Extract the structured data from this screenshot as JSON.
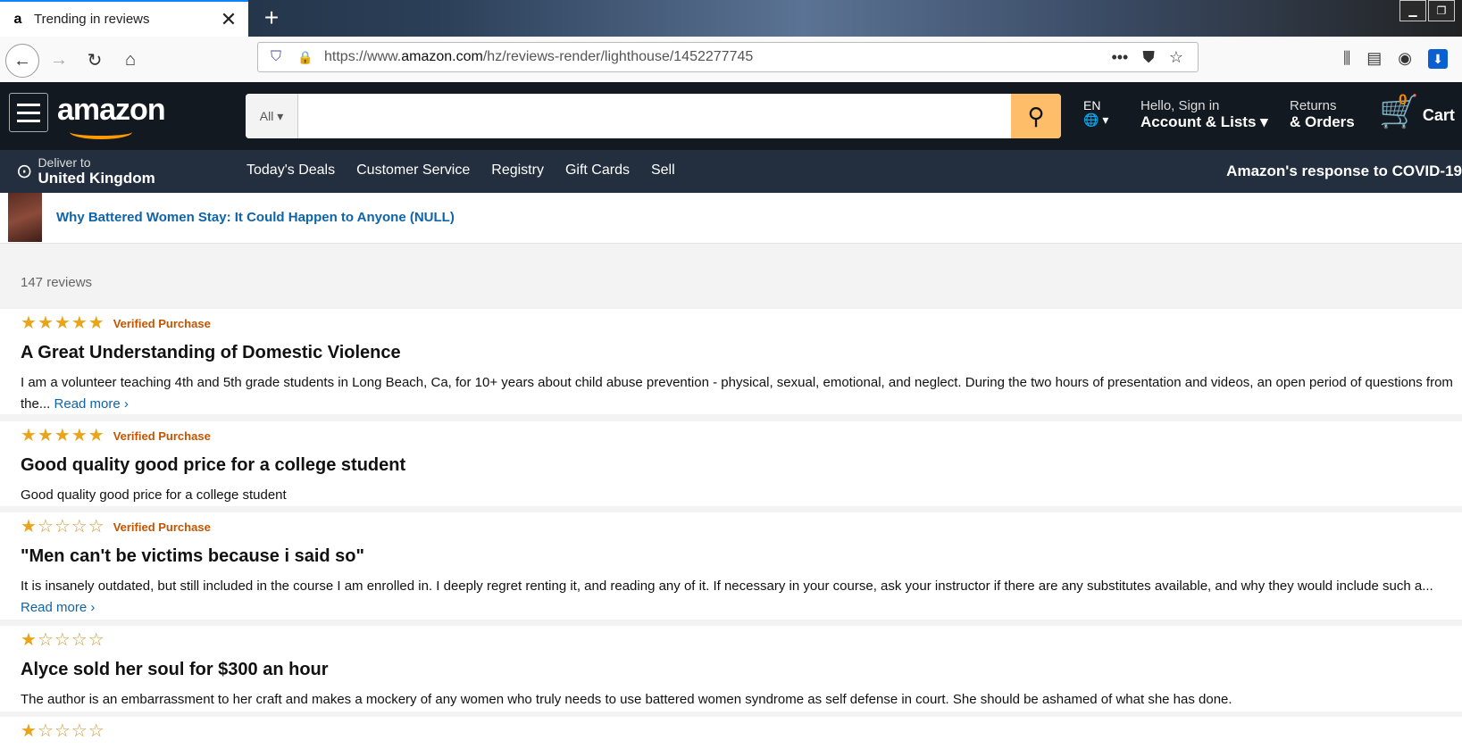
{
  "browser": {
    "tab_title": "Trending in reviews",
    "favicon": "a",
    "close_glyph": "✕",
    "new_tab_glyph": "+",
    "url_prefix": "https://www.",
    "url_domain": "amazon.com",
    "url_path": "/hz/reviews-render/lighthouse/1452277745"
  },
  "header": {
    "logo": "amazon",
    "search_category": "All",
    "search_value": "",
    "lang": "EN",
    "account_line1": "Hello, Sign in",
    "account_line2": "Account & Lists",
    "returns_line1": "Returns",
    "returns_line2": "& Orders",
    "cart_count": "0",
    "cart_label": "Cart",
    "deliver_line1": "Deliver to",
    "deliver_line2": "United Kingdom",
    "nav_items": [
      "Today's Deals",
      "Customer Service",
      "Registry",
      "Gift Cards",
      "Sell"
    ],
    "covid": "Amazon's response to COVID-19"
  },
  "product": {
    "title": "Why Battered Women Stay: It Could Happen to Anyone (NULL)"
  },
  "reviews_count": "147 reviews",
  "reviews": [
    {
      "rating": 5,
      "verified": "Verified Purchase",
      "title": "A Great Understanding of Domestic Violence",
      "body": "I am a volunteer teaching 4th and 5th grade students in Long Beach, Ca, for 10+ years about child abuse prevention - physical, sexual, emotional, and neglect. During the two hours of presentation and videos, an open period of questions from the...",
      "more": "Read more ›"
    },
    {
      "rating": 5,
      "verified": "Verified Purchase",
      "title": "Good quality good price for a college student",
      "body": "Good quality good price for a college student",
      "more": ""
    },
    {
      "rating": 1,
      "verified": "Verified Purchase",
      "title": "\"Men can't be victims because i said so\"",
      "body": "It is insanely outdated, but still included in the course I am enrolled in. I deeply regret renting it, and reading any of it. If necessary in your course, ask your instructor if there are any substitutes available, and why they would include such a...",
      "more": "Read more ›"
    },
    {
      "rating": 1,
      "verified": "",
      "title": "Alyce sold her soul for $300 an hour",
      "body": "The author is an embarrassment to her craft and makes a mockery of any women who truly needs to use battered women syndrome as self defense in court. She should be ashamed of what she has done.",
      "more": ""
    },
    {
      "rating": 1,
      "verified": "",
      "title": "",
      "body": "",
      "more": ""
    }
  ]
}
